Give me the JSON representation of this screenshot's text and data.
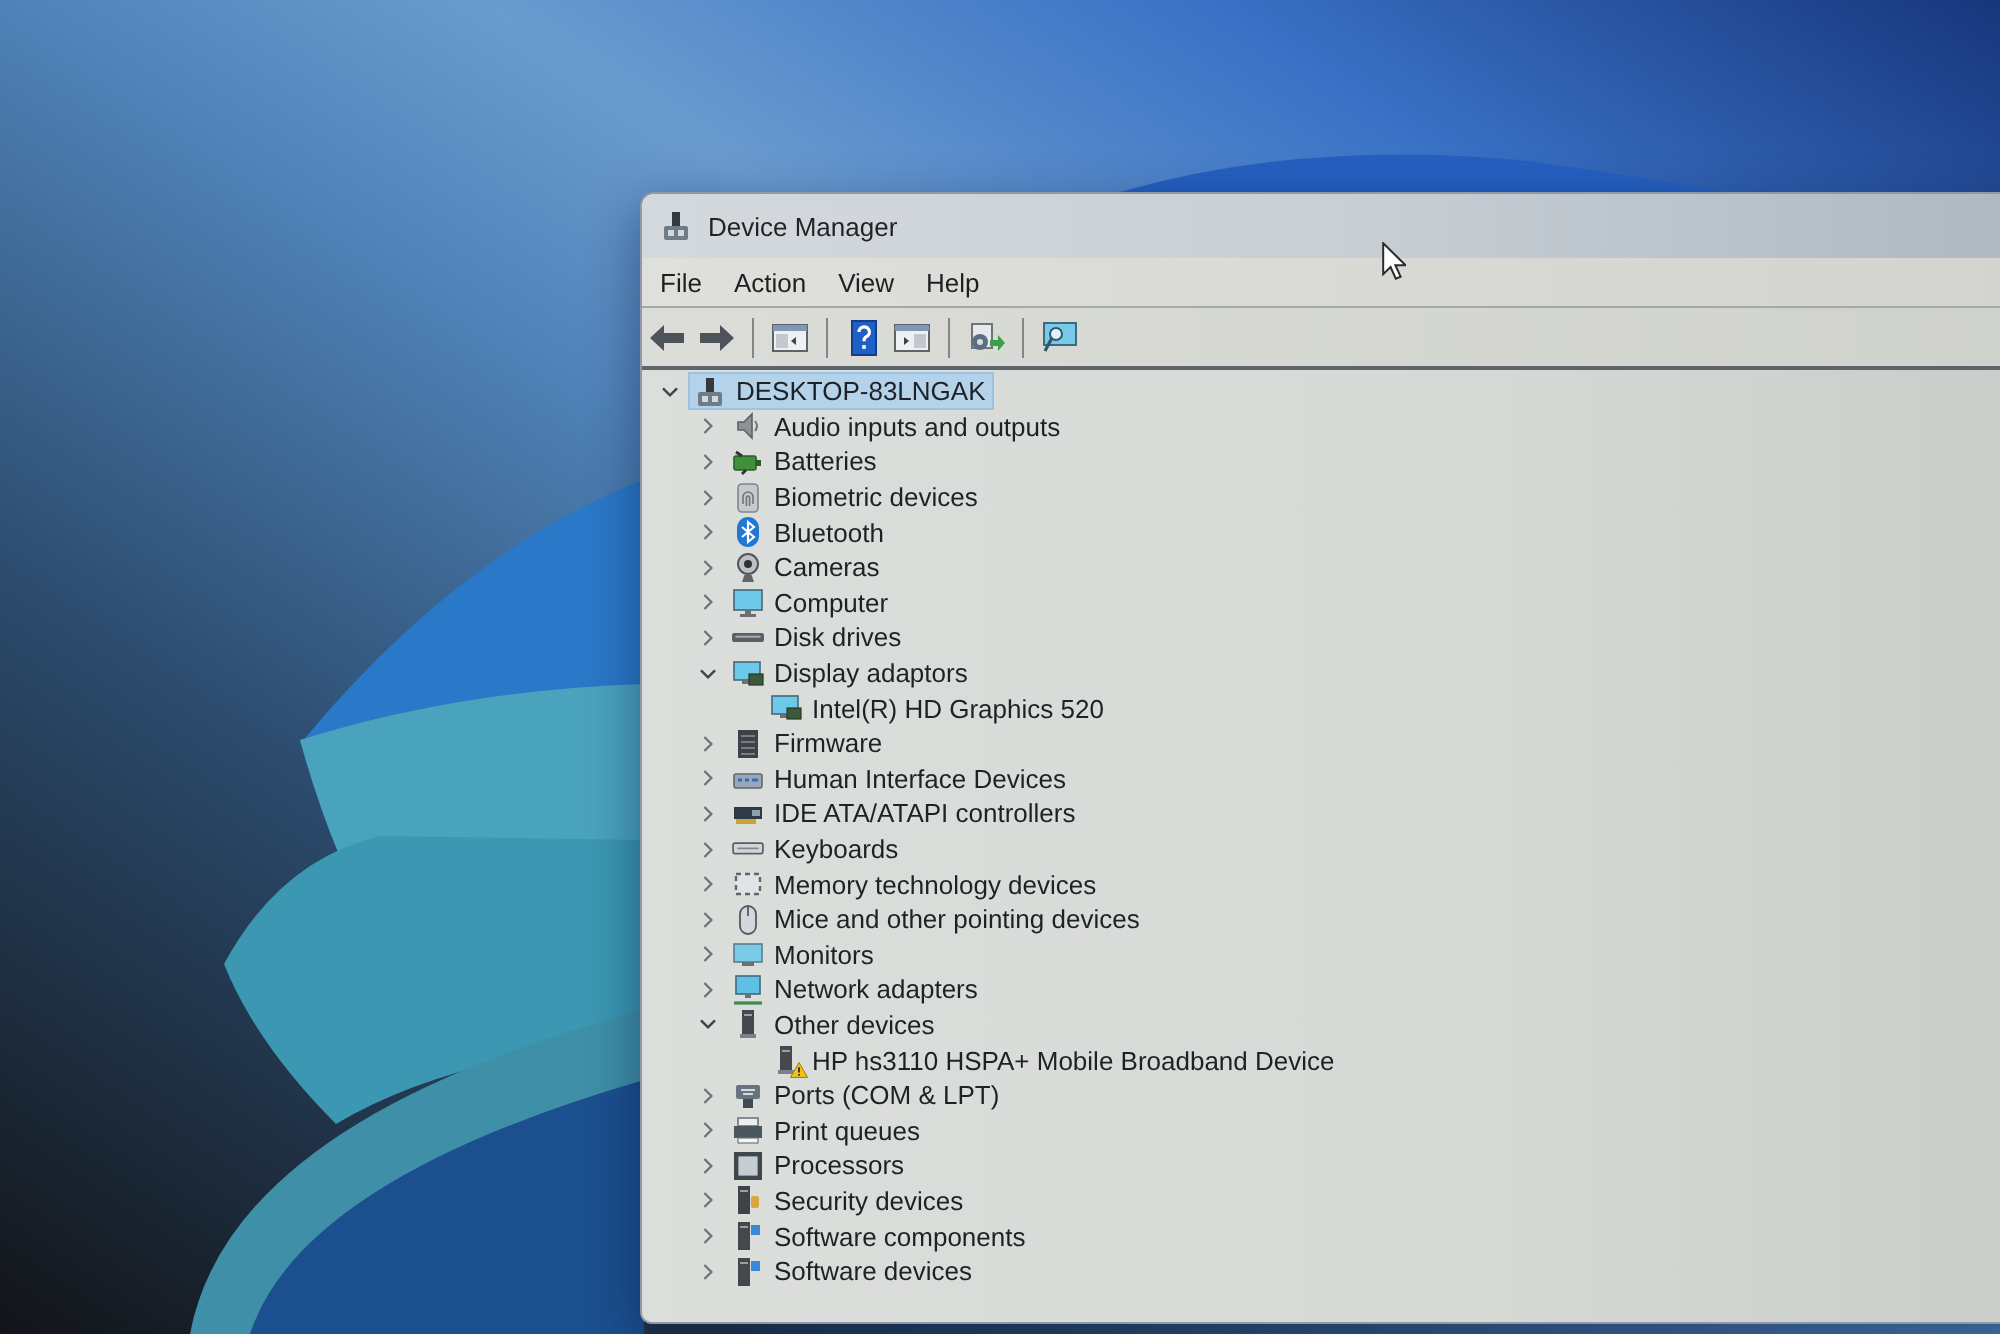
{
  "window": {
    "title": "Device Manager"
  },
  "menu": [
    {
      "label": "File"
    },
    {
      "label": "Action"
    },
    {
      "label": "View"
    },
    {
      "label": "Help"
    }
  ],
  "tree": {
    "label": "DESKTOP-83LNGAK",
    "kind": "host",
    "expanded": true,
    "selected": true,
    "children": [
      {
        "label": "Audio inputs and outputs",
        "kind": "audio",
        "expanded": false,
        "selected": false
      },
      {
        "label": "Batteries",
        "kind": "battery",
        "expanded": false,
        "selected": false
      },
      {
        "label": "Biometric devices",
        "kind": "biometric",
        "expanded": false,
        "selected": false
      },
      {
        "label": "Bluetooth",
        "kind": "bluetooth",
        "expanded": false,
        "selected": false
      },
      {
        "label": "Cameras",
        "kind": "camera",
        "expanded": false,
        "selected": false
      },
      {
        "label": "Computer",
        "kind": "computer",
        "expanded": false,
        "selected": false
      },
      {
        "label": "Disk drives",
        "kind": "disk",
        "expanded": false,
        "selected": false
      },
      {
        "label": "Display adaptors",
        "kind": "display",
        "expanded": true,
        "selected": false,
        "children": [
          {
            "label": "Intel(R) HD Graphics 520",
            "kind": "display",
            "selected": false,
            "warning": false
          }
        ]
      },
      {
        "label": "Firmware",
        "kind": "firmware",
        "expanded": false,
        "selected": false
      },
      {
        "label": "Human Interface Devices",
        "kind": "hid",
        "expanded": false,
        "selected": false
      },
      {
        "label": "IDE ATA/ATAPI controllers",
        "kind": "ide",
        "expanded": false,
        "selected": false
      },
      {
        "label": "Keyboards",
        "kind": "keyboard",
        "expanded": false,
        "selected": false
      },
      {
        "label": "Memory technology devices",
        "kind": "memory",
        "expanded": false,
        "selected": false
      },
      {
        "label": "Mice and other pointing devices",
        "kind": "mouse",
        "expanded": false,
        "selected": false
      },
      {
        "label": "Monitors",
        "kind": "monitor",
        "expanded": false,
        "selected": false
      },
      {
        "label": "Network adapters",
        "kind": "network",
        "expanded": false,
        "selected": false
      },
      {
        "label": "Other devices",
        "kind": "other",
        "expanded": true,
        "selected": false,
        "children": [
          {
            "label": "HP hs3110 HSPA+ Mobile Broadband Device",
            "kind": "other",
            "selected": false,
            "warning": true
          }
        ]
      },
      {
        "label": "Ports (COM & LPT)",
        "kind": "port",
        "expanded": false,
        "selected": false
      },
      {
        "label": "Print queues",
        "kind": "printer",
        "expanded": false,
        "selected": false
      },
      {
        "label": "Processors",
        "kind": "processor",
        "expanded": false,
        "selected": false
      },
      {
        "label": "Security devices",
        "kind": "security",
        "expanded": false,
        "selected": false
      },
      {
        "label": "Software components",
        "kind": "software",
        "expanded": false,
        "selected": false
      },
      {
        "label": "Software devices",
        "kind": "software",
        "expanded": false,
        "selected": false
      }
    ]
  }
}
